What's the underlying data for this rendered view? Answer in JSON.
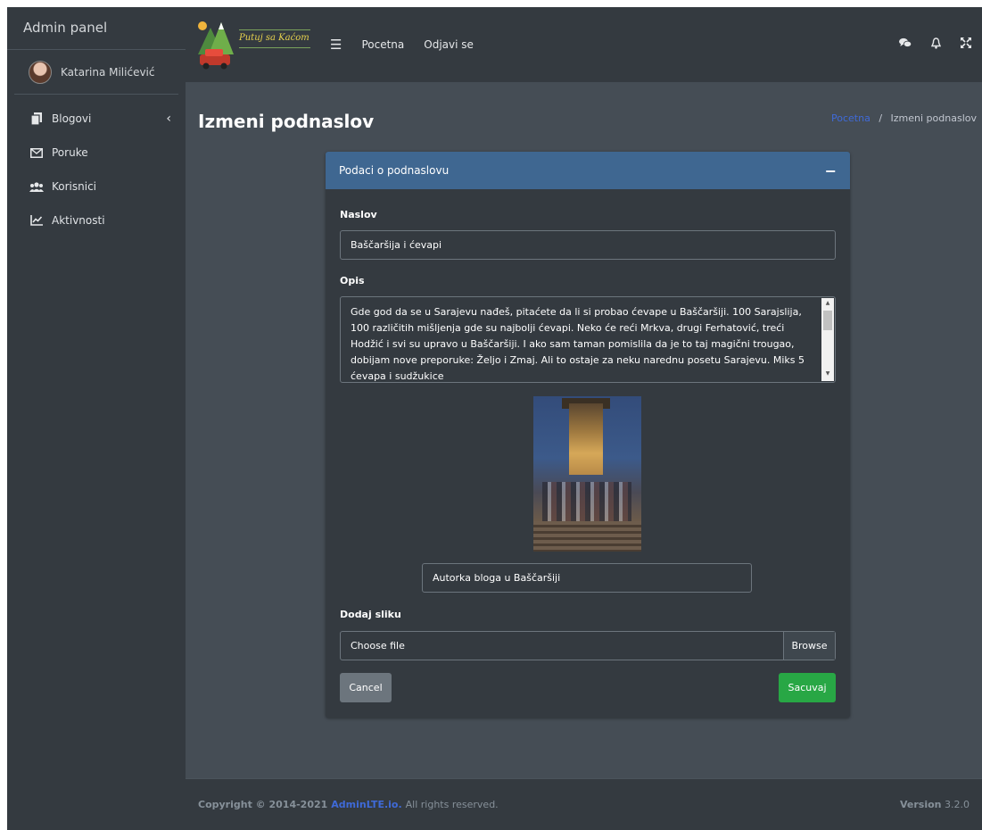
{
  "sidebar": {
    "brand": "Admin panel",
    "user_name": "Katarina Milićević",
    "items": [
      {
        "label": "Blogovi"
      },
      {
        "label": "Poruke"
      },
      {
        "label": "Korisnici"
      },
      {
        "label": "Aktivnosti"
      }
    ]
  },
  "topbar": {
    "logo_text": "Putuj sa Kaćom",
    "links": [
      "Pocetna",
      "Odjavi se"
    ]
  },
  "page": {
    "title": "Izmeni podnaslov",
    "breadcrumb_home": "Pocetna",
    "breadcrumb_sep": "/",
    "breadcrumb_current": "Izmeni podnaslov"
  },
  "card": {
    "header": "Podaci o podnaslovu",
    "naslov_label": "Naslov",
    "naslov_value": "Baščaršija i ćevapi",
    "opis_label": "Opis",
    "opis_value": "Gde god da se u Sarajevu nađeš, pitaćete da li si probao ćevape u Baščaršiji. 100 Sarajslija, 100 različitih mišljenja gde su najbolji ćevapi. Neko će reći Mrkva, drugi Ferhatović, treći Hodžić i svi su upravo u Baščaršiji. I ako sam taman pomislila da je to taj magični trougao, dobijam nove preporuke: Željo i Zmaj. Ali to ostaje za neku narednu posetu Sarajevu. Miks 5 ćevapa i sudžukice",
    "caption_value": "Autorka bloga u Baščaršiji",
    "image_label": "Dodaj sliku",
    "file_placeholder": "Choose file",
    "browse_label": "Browse",
    "cancel_label": "Cancel",
    "save_label": "Sacuvaj"
  },
  "footer": {
    "copyright_prefix": "Copyright © 2014-2021",
    "brand_link": "AdminLTE.io.",
    "rights": "All rights reserved.",
    "version_label": "Version",
    "version_value": "3.2.0"
  },
  "colors": {
    "accent": "#3f6791",
    "success": "#28a745",
    "link": "#3f6ad8"
  }
}
